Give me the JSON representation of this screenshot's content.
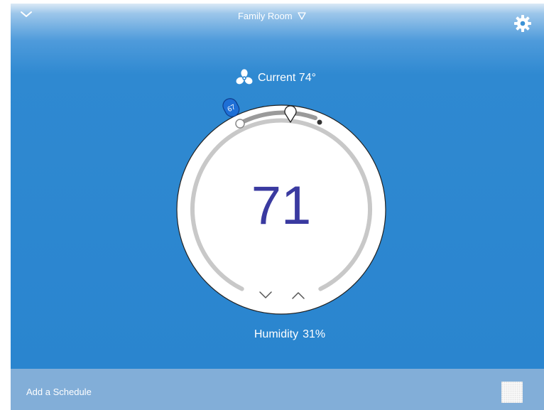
{
  "header": {
    "room_name": "Family Room"
  },
  "status": {
    "current_label": "Current 74°"
  },
  "dial": {
    "setpoint": "71",
    "setpoint_marker_label": "67"
  },
  "humidity": {
    "label": "Humidity",
    "value": "31%"
  },
  "footer": {
    "add_schedule_label": "Add a Schedule"
  },
  "colors": {
    "background_blue": "#2a85cf",
    "footer_bar": "#82aed8",
    "setpoint_text": "#3a3aa0",
    "marker_blue": "#1e6fd6",
    "track_gray": "#c8c8c8"
  },
  "icons": {
    "collapse": "chevron-down-icon",
    "room_dropdown": "triangle-down-icon",
    "settings": "gear-icon",
    "fan": "fan-icon",
    "decrease": "chevron-down-icon",
    "increase": "chevron-up-icon",
    "schedule": "calendar-grid-icon"
  }
}
